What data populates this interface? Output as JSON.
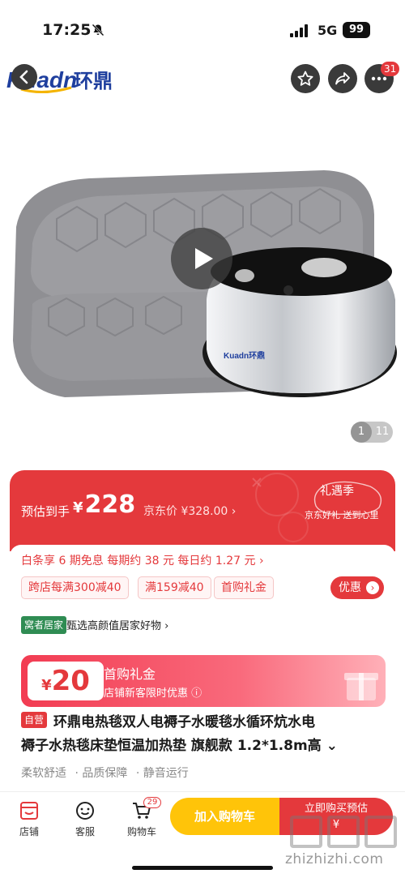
{
  "status_bar": {
    "time": "17:25",
    "network": "5G",
    "battery": "99"
  },
  "header": {
    "logo_text": "Kuadn环鼎",
    "cart_badge": "31",
    "icons": [
      "back-icon",
      "star-icon",
      "share-icon",
      "more-icon"
    ]
  },
  "gallery": {
    "current": "1",
    "total": "11",
    "product_logo": "Kuadn环鼎"
  },
  "price": {
    "est_label": "预估到手",
    "currency": "¥",
    "est_value": "228",
    "jd_price": "京东价 ¥328.00 ›",
    "gift_title": "礼遇季",
    "gift_sub": "京东好礼 送到心里"
  },
  "promo": {
    "baitiao": "白条享 6 期免息  每期约 38 元  每日约 1.27 元 ›",
    "coupons": [
      "跨店每满300减40",
      "满159减40",
      "首购礼金"
    ],
    "youhui": "优惠"
  },
  "shop": {
    "tag": "窝者居家",
    "desc": "甄选高颜值居家好物 ›"
  },
  "new_gift": {
    "currency": "¥",
    "amount": "20",
    "title": "首购礼金",
    "sub": "店铺新客限时优惠 ⓘ"
  },
  "product": {
    "self_tag": "自营",
    "title_line1": "环鼎电热毯双人电褥子水暖毯水循环炕水电",
    "title_line2": "褥子水热毯床垫恒温加热垫 旗舰款 1.2*1.8m高 ⌄",
    "features": [
      "柔软舒适",
      "· 品质保障",
      "· 静音运行"
    ]
  },
  "bottom_bar": {
    "store": "店铺",
    "service": "客服",
    "cart": "购物车",
    "cart_count": "29",
    "add_to_cart": "加入购物车",
    "buy_now": "立即购买预估",
    "buy_now_sub": "¥"
  },
  "watermark": {
    "text": "zhizhizhi.com"
  },
  "colors": {
    "accent": "#e4393c",
    "yellow": "#ffc409",
    "green": "#2f8c53"
  }
}
